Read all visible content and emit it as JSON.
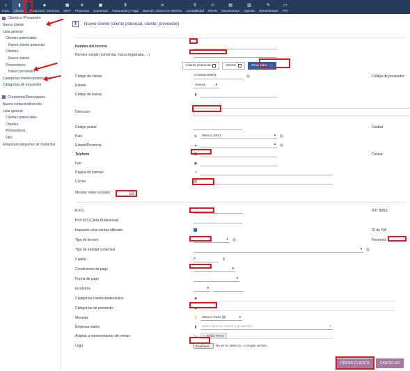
{
  "topbar": {
    "items": [
      {
        "label": "Inicio",
        "icon": "home-icon",
        "glyph": "⌂"
      },
      {
        "label": "Clientes",
        "icon": "building-icon",
        "glyph": "▮"
      },
      {
        "label": "Productos | Servicios",
        "icon": "cube-icon",
        "glyph": "◈"
      },
      {
        "label": "MRP",
        "icon": "cubes-icon",
        "glyph": "▦"
      },
      {
        "label": "Proyectos",
        "icon": "sitemap-icon",
        "glyph": "⋔"
      },
      {
        "label": "Comercial",
        "icon": "suitcase-icon",
        "glyph": "▣"
      },
      {
        "label": "Facturación | Pago",
        "icon": "invoice-icon",
        "glyph": "$"
      },
      {
        "label": "Bancos | Dinero en efectivo",
        "icon": "bank-icon",
        "glyph": "⌗"
      },
      {
        "label": "Contabilidad",
        "icon": "search-dollar-icon",
        "glyph": "⚲"
      },
      {
        "label": "RRHH",
        "icon": "users-icon",
        "glyph": "☺"
      },
      {
        "label": "Documentos",
        "icon": "folder-icon",
        "glyph": "▤"
      },
      {
        "label": "Agenda",
        "icon": "calendar-icon",
        "glyph": "▥"
      },
      {
        "label": "Herramientas",
        "icon": "wrench-icon",
        "glyph": "✎"
      },
      {
        "label": "TPV",
        "icon": "cash-register-icon",
        "glyph": "▭"
      }
    ]
  },
  "left": {
    "section1_title": "Cliente o Proveedor",
    "items1": [
      {
        "label": "Nuevo cliente",
        "level": 1
      },
      {
        "label": "Lista general",
        "level": 1
      },
      {
        "label": "Clientes potenciales",
        "level": 2
      },
      {
        "label": "Nuevo cliente potencial",
        "level": 3
      },
      {
        "label": "Clientes",
        "level": 2
      },
      {
        "label": "Nuevo cliente",
        "level": 3
      },
      {
        "label": "Proveedores",
        "level": 2
      },
      {
        "label": "Nuevo proveedor",
        "level": 3
      },
      {
        "label": "Categorías clientes/potenciales",
        "level": 1
      },
      {
        "label": "Categorías de proveedor",
        "level": 1
      }
    ],
    "section2_title": "Contactos/Direcciones",
    "items2": [
      {
        "label": "Nuevo contacto/dirección",
        "level": 1
      },
      {
        "label": "Lista general",
        "level": 1
      },
      {
        "label": "Clientes potenciales",
        "level": 2
      },
      {
        "label": "Clientes",
        "level": 2
      },
      {
        "label": "Proveedores",
        "level": 2
      },
      {
        "label": "Otro",
        "level": 2
      },
      {
        "label": "Etiquetas/categorías de contactos",
        "level": 1
      }
    ]
  },
  "form": {
    "page_title": "Nuevo cliente (cliente potencial, cliente, proveedor)",
    "name_label": "Nombre del tercero",
    "alias_label": "Nombre simple (comercial, marca registrada, ...)",
    "third_type": {
      "prospect": "Cliente potencial",
      "customer": "Cliente",
      "supplier": "Proveedor"
    },
    "customer_code_label": "Código de cliente",
    "customer_code_value": "CU2505-00004",
    "supplier_code_label": "Código de proveedor",
    "status_label": "Estado",
    "status_value": "Abierta",
    "barcode_label": "Código de barras",
    "address_label": "Dirección",
    "zip_label": "Código postal",
    "town_label": "Ciudad",
    "country_label": "País",
    "country_value": "México (MX)",
    "state_label": "Estado/Provincia",
    "phone_label": "Teléfono",
    "mobile_label": "Celular",
    "fax_label": "Fax",
    "web_label": "Página de internet",
    "email_label": "Correo",
    "social_label": "Mostrar redes sociales",
    "rfc_label": "R.F.C.",
    "rp_label": "R.P. IMSS",
    "prof3_label": "Prof Id 3 (Carta Profesional)",
    "vat_used_label": "Impuesto a las ventas utilizado",
    "vat_id_label": "ID de IVA",
    "third_kind_label": "Tipo de tercero",
    "staff_label": "Personal",
    "entity_kind_label": "Tipo de entidad comercial",
    "capital_label": "Capital",
    "capital_value": "0",
    "capital_currency": "$",
    "payment_terms_label": "Condiciones de pago",
    "payment_mode_label": "Forma de pago",
    "incoterms_label": "Incoterms",
    "cust_categories_label": "Categorías clientes/potenciales",
    "supp_categories_label": "Categorías de proveedor",
    "currency_label": "Moneda",
    "currency_value": "México Peso ($)",
    "parent_label": "Empresa matriz",
    "parent_placeholder": "Seleccione un cliente o proveedor",
    "sales_rep_label": "Asignar a representantes de ventas",
    "sales_rep_value": "Erasó Pérez",
    "logo_label": "Logo",
    "file_button": "Examinar...",
    "file_status": "No se ha seleccio...o ningún archivo.",
    "create_button": "CREAR CLIENTE",
    "cancel_button": "CANCELAR"
  },
  "colors": {
    "topbar": "#263c5c",
    "accent": "#a779a0",
    "annotation": "#e0161b"
  }
}
